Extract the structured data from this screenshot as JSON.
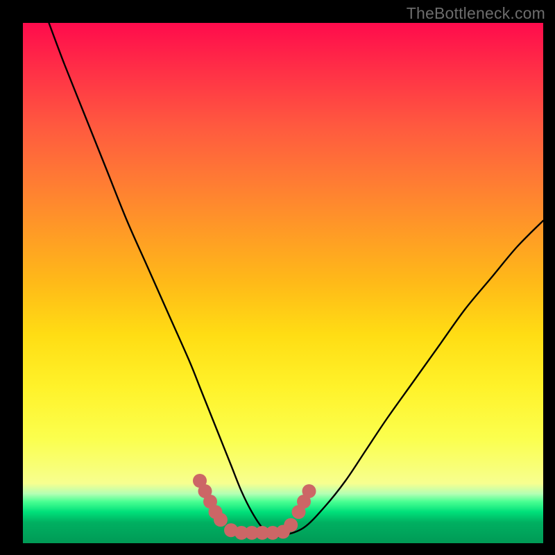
{
  "watermark": "TheBottleneck.com",
  "chart_data": {
    "type": "line",
    "title": "",
    "xlabel": "",
    "ylabel": "",
    "xlim": [
      0,
      100
    ],
    "ylim": [
      0,
      100
    ],
    "series": [
      {
        "name": "bottleneck-curve",
        "x": [
          5,
          8,
          12,
          16,
          20,
          24,
          28,
          32,
          34,
          36,
          38,
          40,
          42,
          44,
          46,
          48,
          50,
          54,
          58,
          62,
          66,
          70,
          75,
          80,
          85,
          90,
          95,
          100
        ],
        "y": [
          100,
          92,
          82,
          72,
          62,
          53,
          44,
          35,
          30,
          25,
          20,
          15,
          10,
          6,
          3,
          1.5,
          1.5,
          3,
          7,
          12,
          18,
          24,
          31,
          38,
          45,
          51,
          57,
          62
        ]
      }
    ],
    "markers": {
      "name": "highlight-dots",
      "color": "#cc6666",
      "points": [
        {
          "x": 34.0,
          "y": 12.0
        },
        {
          "x": 35.0,
          "y": 10.0
        },
        {
          "x": 36.0,
          "y": 8.0
        },
        {
          "x": 37.0,
          "y": 6.0
        },
        {
          "x": 38.0,
          "y": 4.5
        },
        {
          "x": 40.0,
          "y": 2.5
        },
        {
          "x": 42.0,
          "y": 2.0
        },
        {
          "x": 44.0,
          "y": 2.0
        },
        {
          "x": 46.0,
          "y": 2.0
        },
        {
          "x": 48.0,
          "y": 2.0
        },
        {
          "x": 50.0,
          "y": 2.2
        },
        {
          "x": 51.5,
          "y": 3.5
        },
        {
          "x": 53.0,
          "y": 6.0
        },
        {
          "x": 54.0,
          "y": 8.0
        },
        {
          "x": 55.0,
          "y": 10.0
        }
      ]
    },
    "gradient_stops": [
      {
        "pos": 0.0,
        "color": "#ff0b4c"
      },
      {
        "pos": 0.5,
        "color": "#ffdd14"
      },
      {
        "pos": 0.88,
        "color": "#f7ff8f"
      },
      {
        "pos": 0.92,
        "color": "#4aff92"
      },
      {
        "pos": 1.0,
        "color": "#009a56"
      }
    ]
  }
}
